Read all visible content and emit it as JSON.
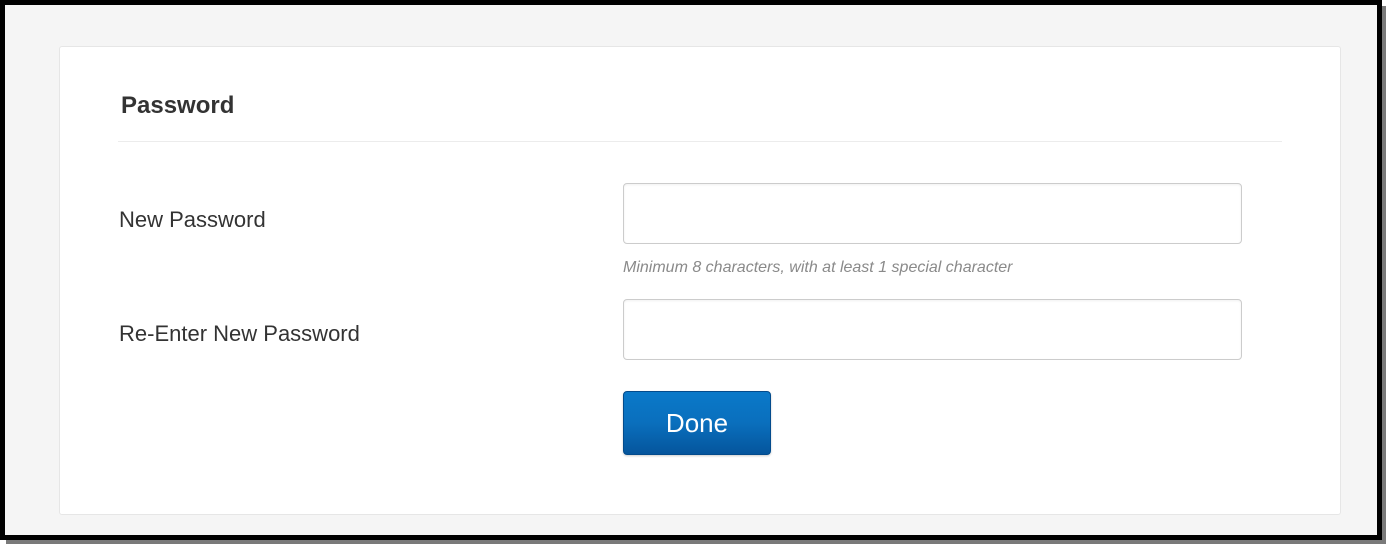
{
  "section": {
    "title": "Password"
  },
  "fields": {
    "new_password": {
      "label": "New Password",
      "value": "",
      "placeholder": "",
      "help": "Minimum 8 characters, with at least 1 special character"
    },
    "reenter_password": {
      "label": "Re-Enter New Password",
      "value": "",
      "placeholder": ""
    }
  },
  "actions": {
    "done_label": "Done"
  },
  "colors": {
    "button": "#0a6fbd",
    "help_text": "#8a8a8a",
    "label_text": "#333333"
  }
}
